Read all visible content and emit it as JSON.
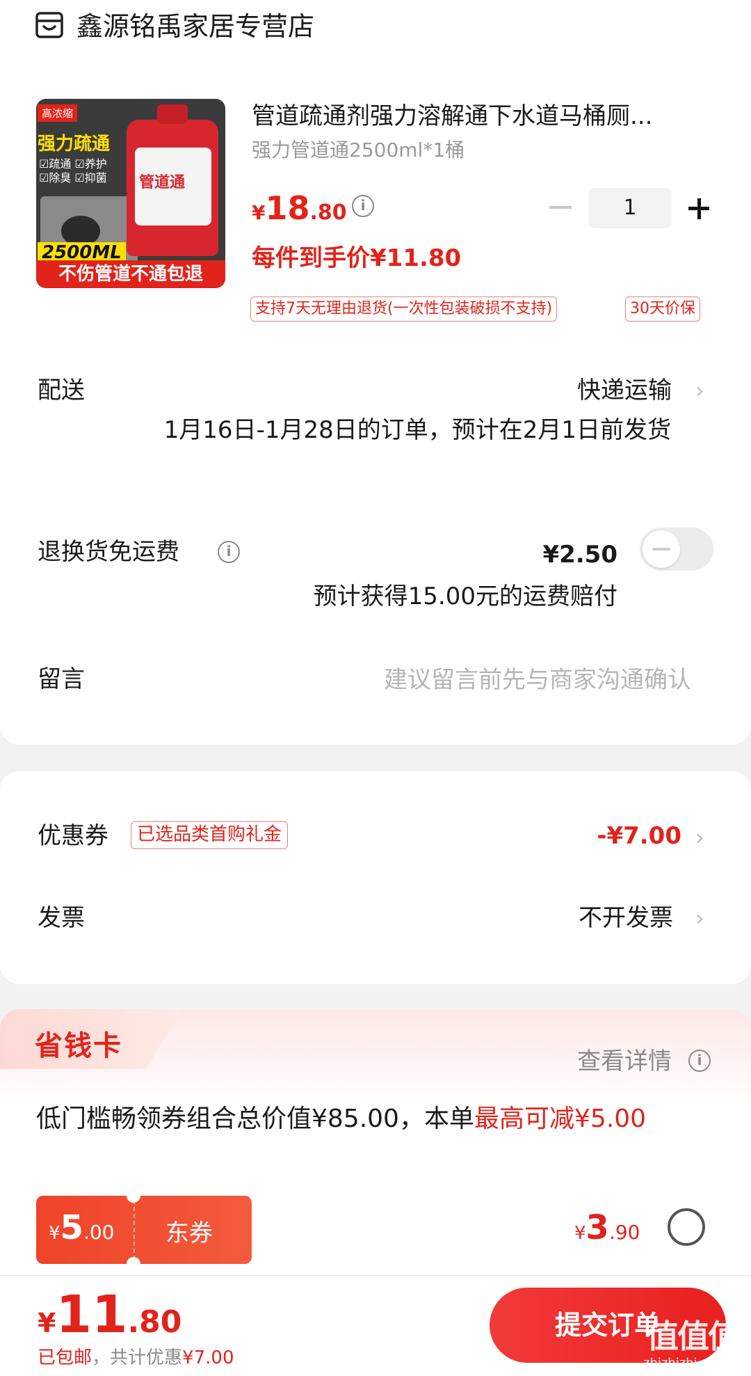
{
  "store": {
    "name": "鑫源铭禹家居专营店",
    "icon": "store-icon"
  },
  "product": {
    "title": "管道疏通剂强力溶解通下水道马桶厕...",
    "spec": "强力管道通2500ml*1桶",
    "price": {
      "currency": "¥",
      "integer": "18",
      "decimal": ".80"
    },
    "quantity": "1",
    "each_price": "每件到手价¥11.80",
    "tags": [
      "支持7天无理由退货(一次性包装破损不支持)",
      "30天价保"
    ],
    "image_text": {
      "tag": "高浓缩",
      "title": "强力疏通",
      "features": [
        "☑疏通 ☑养护",
        "☑除臭 ☑抑菌"
      ],
      "bottle": "管道通",
      "volume": "2500ML",
      "bottom": "不伤管道不通包退"
    }
  },
  "delivery": {
    "label": "配送",
    "value": "快递运输",
    "note": "1月16日-1月28日的订单，预计在2月1日前发货"
  },
  "return_shipping": {
    "label": "退换货免运费",
    "price": "¥2.50",
    "note": "预计获得15.00元的运费赔付",
    "toggle": false
  },
  "message": {
    "label": "留言",
    "placeholder": "建议留言前先与商家沟通确认"
  },
  "coupon": {
    "label": "优惠券",
    "tag": "已选品类首购礼金",
    "value": "-¥7.00"
  },
  "invoice": {
    "label": "发票",
    "value": "不开发票"
  },
  "saving_card": {
    "title": "省钱卡",
    "detail_label": "查看详情",
    "desc_prefix": "低门槛畅领券组合总价值¥85.00，本单",
    "desc_highlight": "最高可减¥5.00",
    "voucher": {
      "currency": "¥",
      "integer": "5",
      "decimal": ".00",
      "label": "东券"
    },
    "price": {
      "currency": "¥",
      "integer": "3",
      "decimal": ".90"
    },
    "selected": false
  },
  "bottom_bar": {
    "total": {
      "currency": "¥",
      "integer": "11",
      "decimal": ".80"
    },
    "free_shipping": "已包邮",
    "separator": "，",
    "discount_prefix": "共计优惠",
    "discount_value": "¥7.00",
    "submit": "提交订单"
  },
  "watermark": {
    "logo": "值值值",
    "url": "zhizhizhi.com"
  },
  "colors": {
    "accent": "#e2231a",
    "background": "#f2f2f2",
    "card": "#ffffff",
    "muted": "#999999"
  }
}
